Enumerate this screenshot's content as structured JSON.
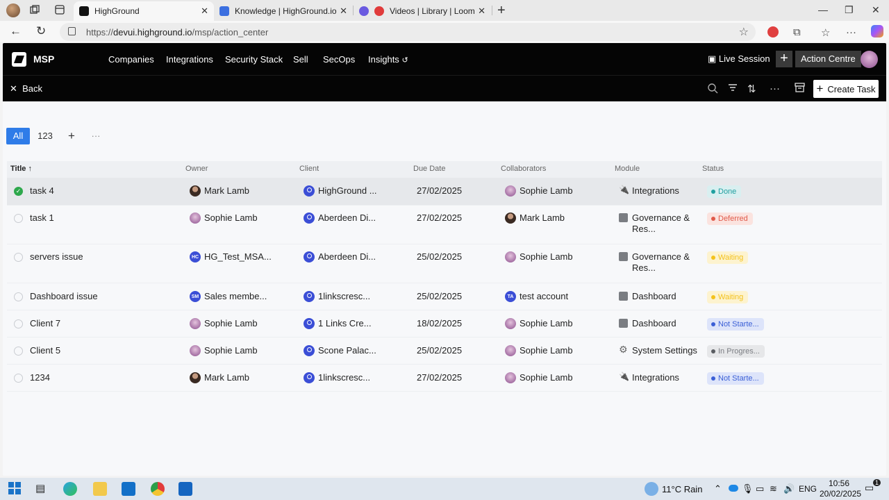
{
  "browser": {
    "tabs": [
      {
        "title": "HighGround",
        "active": true
      },
      {
        "title": "Knowledge | HighGround.io | Inte",
        "active": false
      },
      {
        "title": "Videos | Library | Loom",
        "active": false
      }
    ],
    "url_prefix": "https://",
    "url_host": "devui.highground.io",
    "url_path": "/msp/action_center"
  },
  "app": {
    "brand": "MSP",
    "nav": [
      "Companies",
      "Integrations",
      "Security Stack",
      "Sell",
      "SecOps",
      "Insights"
    ],
    "live_session": "Live Session",
    "action_centre": "Action Centre",
    "back": "Back",
    "create_task": "Create Task"
  },
  "views": {
    "all": "All",
    "custom": "123"
  },
  "table": {
    "headers": [
      "Title",
      "Owner",
      "Client",
      "Due Date",
      "Collaborators",
      "Module",
      "Status"
    ],
    "rows": [
      {
        "title": "task 4",
        "owner": "Mark Lamb",
        "client": "HighGround ...",
        "due": "27/02/2025",
        "collab": "Sophie Lamb",
        "module": "Integrations",
        "status": "Done"
      },
      {
        "title": "task 1",
        "owner": "Sophie Lamb",
        "client": "Aberdeen Di...",
        "due": "27/02/2025",
        "collab": "Mark Lamb",
        "module_l1": "Governance &",
        "module_l2": "Res...",
        "status": "Deferred"
      },
      {
        "title": "servers issue",
        "owner": "HG_Test_MSA...",
        "owner_initials": "HC",
        "client": "Aberdeen Di...",
        "due": "25/02/2025",
        "collab": "Sophie Lamb",
        "module_l1": "Governance &",
        "module_l2": "Res...",
        "status": "Waiting"
      },
      {
        "title": "Dashboard issue",
        "owner": "Sales membe...",
        "owner_initials": "SM",
        "client": "1linkscresc...",
        "due": "25/02/2025",
        "collab": "test account",
        "collab_initials": "TA",
        "module": "Dashboard",
        "status": "Waiting"
      },
      {
        "title": "Client 7",
        "owner": "Sophie Lamb",
        "client": "1 Links Cre...",
        "due": "18/02/2025",
        "collab": "Sophie Lamb",
        "module": "Dashboard",
        "status": "Not Starte..."
      },
      {
        "title": "Client 5",
        "owner": "Sophie Lamb",
        "client": "Scone Palac...",
        "due": "25/02/2025",
        "collab": "Sophie Lamb",
        "module": "System Settings",
        "status": "In Progres..."
      },
      {
        "title": "1234",
        "owner": "Mark Lamb",
        "client": "1linkscresc...",
        "due": "27/02/2025",
        "collab": "Sophie Lamb",
        "module": "Integrations",
        "status": "Not Starte..."
      }
    ]
  },
  "status_colors": {
    "done": "#21a0a0",
    "deferred": "#e05a4a",
    "waiting": "#f3c21c",
    "not_started": "#3b5fd6",
    "in_progress": "#7a7d82"
  },
  "taskbar": {
    "weather": "11°C Rain",
    "lang": "ENG",
    "time": "10:56",
    "date": "20/02/2025",
    "badge": "1"
  }
}
